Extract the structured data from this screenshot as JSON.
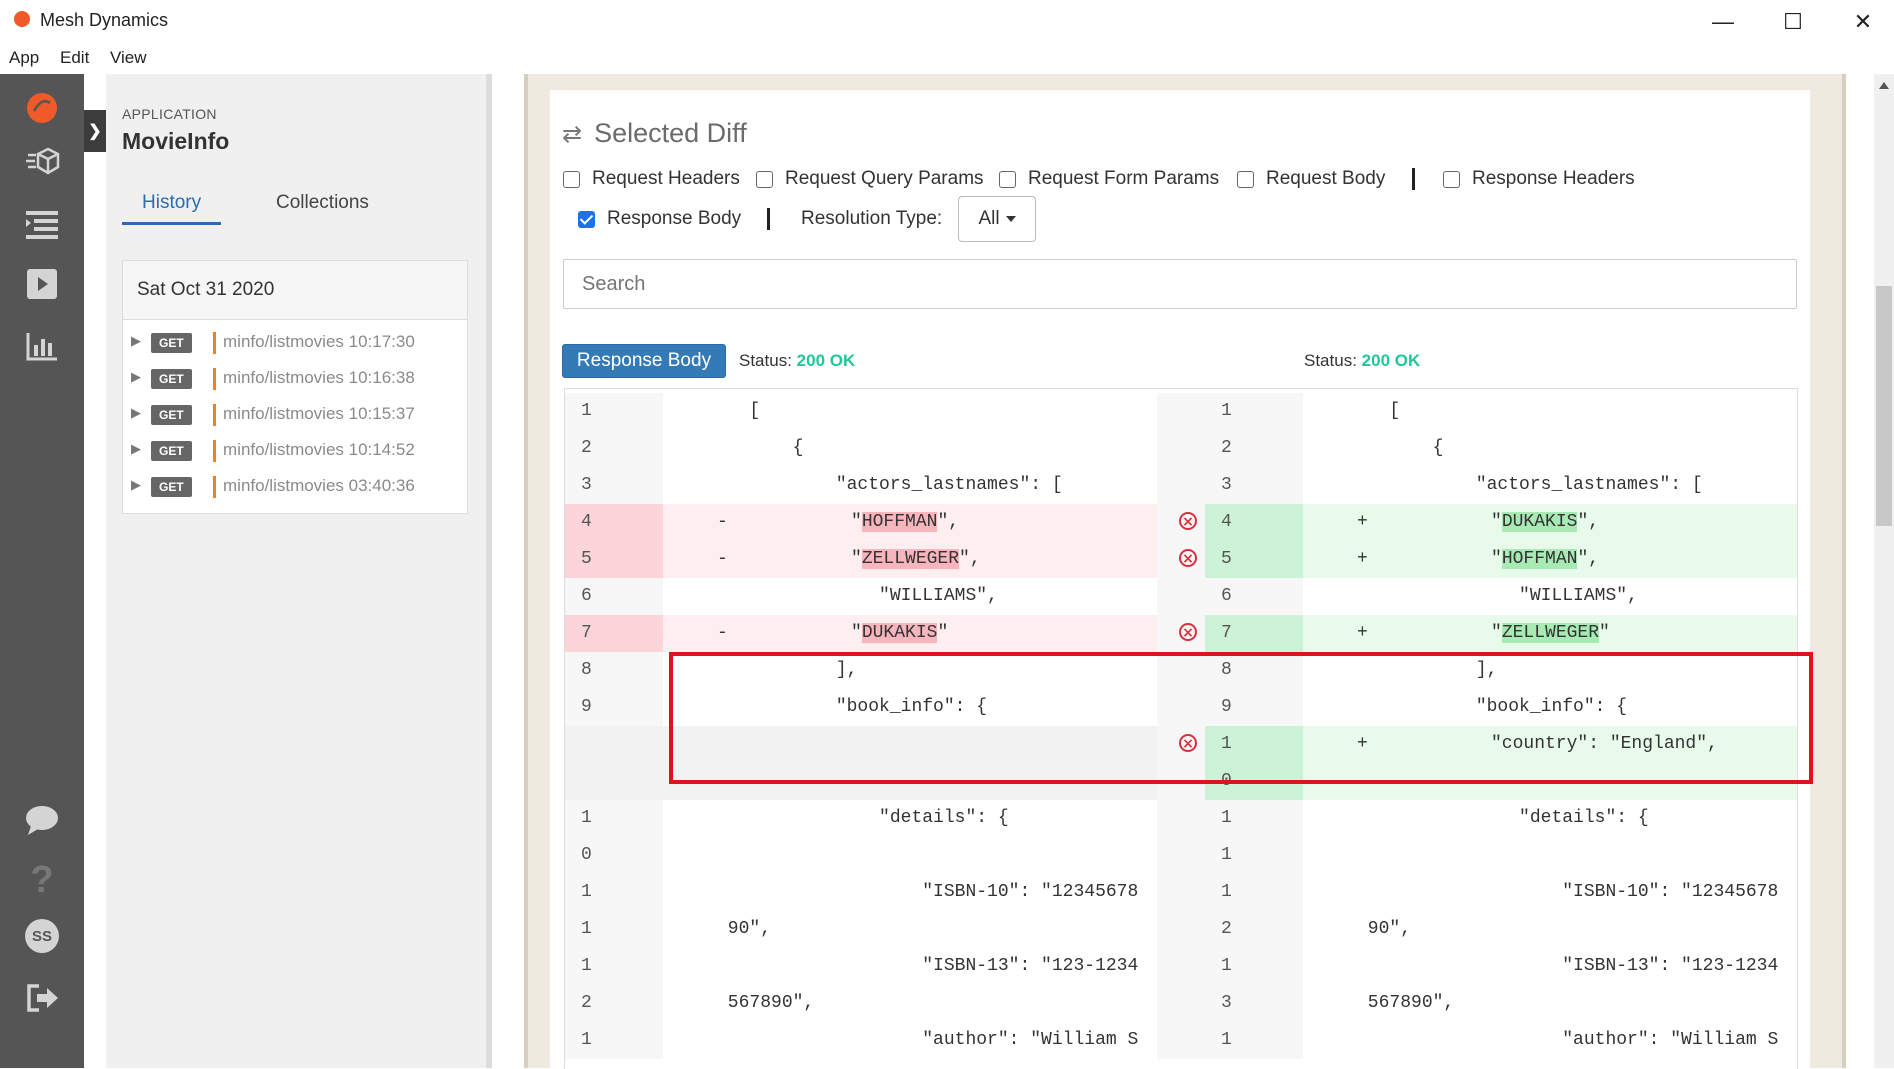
{
  "window": {
    "title": "Mesh Dynamics",
    "minimize": "—",
    "maximize": "☐",
    "close": "✕"
  },
  "menu": [
    "App",
    "Edit",
    "View"
  ],
  "rail": {
    "avatar": "SS"
  },
  "sidebar": {
    "app_label": "APPLICATION",
    "app_name": "MovieInfo",
    "tabs": [
      "History",
      "Collections"
    ],
    "history_date": "Sat Oct 31 2020",
    "history": [
      {
        "method": "GET",
        "path": "minfo/listmovies 10:17:30"
      },
      {
        "method": "GET",
        "path": "minfo/listmovies 10:16:38"
      },
      {
        "method": "GET",
        "path": "minfo/listmovies 10:15:37"
      },
      {
        "method": "GET",
        "path": "minfo/listmovies 10:14:52"
      },
      {
        "method": "GET",
        "path": "minfo/listmovies 03:40:36"
      }
    ]
  },
  "main": {
    "title": "Selected Diff",
    "filters": {
      "req_headers": "Request Headers",
      "req_query": "Request Query Params",
      "req_form": "Request Form Params",
      "req_body": "Request Body",
      "resp_headers": "Response Headers",
      "resp_body": "Response Body"
    },
    "resolution_label": "Resolution Type:",
    "resolution_value": "All",
    "search_placeholder": "Search",
    "response_body_button": "Response Body",
    "status_label": "Status:",
    "status_left": "200 OK",
    "status_right": "200 OK"
  },
  "diff": {
    "rows": [
      {
        "ln": "1",
        "left": "        [",
        "rn": "1",
        "right": "        [",
        "type": "same"
      },
      {
        "ln": "2",
        "left": "            {",
        "rn": "2",
        "right": "            {",
        "type": "same"
      },
      {
        "ln": "3",
        "left": "                \"actors_lastnames\": [",
        "rn": "3",
        "right": "                \"actors_lastnames\": [",
        "type": "same"
      },
      {
        "ln": "4",
        "lsign": "-",
        "lpre": "\"",
        "lhl": "HOFFMAN",
        "lpost": "\",",
        "rn": "4",
        "rsign": "+",
        "rpre": "\"",
        "rhl": "DUKAKIS",
        "rpost": "\",",
        "type": "change"
      },
      {
        "ln": "5",
        "lsign": "-",
        "lpre": "\"",
        "lhl": "ZELLWEGER",
        "lpost": "\",",
        "rn": "5",
        "rsign": "+",
        "rpre": "\"",
        "rhl": "HOFFMAN",
        "rpost": "\",",
        "type": "change"
      },
      {
        "ln": "6",
        "left": "                    \"WILLIAMS\",",
        "rn": "6",
        "right": "                    \"WILLIAMS\",",
        "type": "same"
      },
      {
        "ln": "7",
        "lsign": "-",
        "lpre": "\"",
        "lhl": "DUKAKIS",
        "lpost": "\"",
        "rn": "7",
        "rsign": "+",
        "rpre": "\"",
        "rhl": "ZELLWEGER",
        "rpost": "\"",
        "type": "change"
      },
      {
        "ln": "8",
        "left": "                ],",
        "rn": "8",
        "right": "                ],",
        "type": "same"
      },
      {
        "ln": "9",
        "left": "                \"book_info\": {",
        "rn": "9",
        "right": "                \"book_info\": {",
        "type": "same"
      },
      {
        "ln": "",
        "left": "",
        "rn": "1",
        "rsign": "+",
        "right": "\"country\": \"England\",",
        "type": "add"
      },
      {
        "ln": "",
        "left": "",
        "rn": "0",
        "right": "",
        "type": "add-cont"
      },
      {
        "ln": "1",
        "left": "                    \"details\": {",
        "rn": "1",
        "right": "                    \"details\": {",
        "type": "same"
      },
      {
        "ln": "0",
        "left": "",
        "rn": "1",
        "right": "",
        "type": "same"
      },
      {
        "ln": "1",
        "left": "                        \"ISBN-10\": \"12345678",
        "rn": "1",
        "right": "                        \"ISBN-10\": \"12345678",
        "type": "same"
      },
      {
        "ln": "1",
        "left": "      90\",",
        "rn": "2",
        "right": "      90\",",
        "type": "same"
      },
      {
        "ln": "1",
        "left": "                        \"ISBN-13\": \"123-1234",
        "rn": "1",
        "right": "                        \"ISBN-13\": \"123-1234",
        "type": "same"
      },
      {
        "ln": "2",
        "left": "      567890\",",
        "rn": "3",
        "right": "      567890\",",
        "type": "same"
      },
      {
        "ln": "1",
        "left": "                        \"author\": \"William S",
        "rn": "1",
        "right": "                        \"author\": \"William S",
        "type": "same"
      }
    ]
  }
}
